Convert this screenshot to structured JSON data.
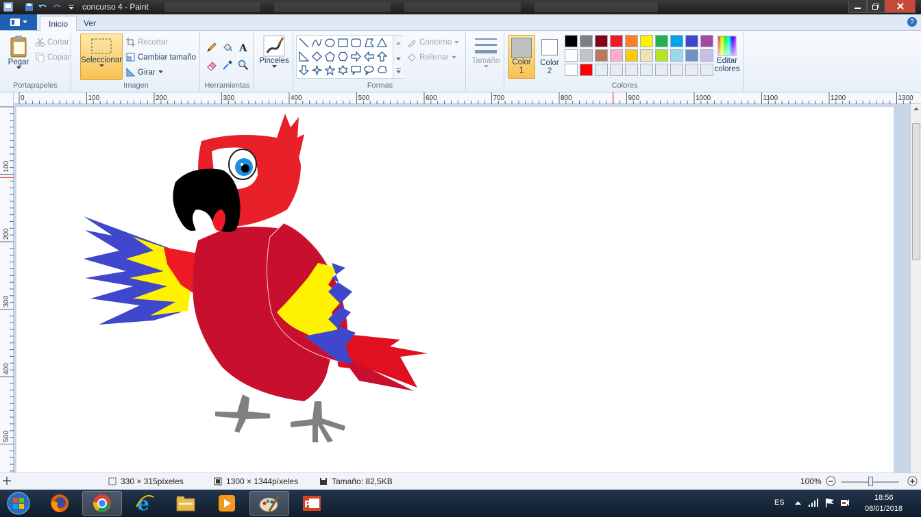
{
  "window": {
    "title": "concurso 4 - Paint"
  },
  "tabs": [
    {
      "label": "Inicio",
      "active": true
    },
    {
      "label": "Ver",
      "active": false
    }
  ],
  "ribbon": {
    "portapapeles": {
      "label": "Portapapeles",
      "paste": "Pegar",
      "cut": "Cortar",
      "copy": "Copiar"
    },
    "imagen": {
      "label": "Imagen",
      "select": "Seleccionar",
      "crop": "Recortar",
      "resize": "Cambiar tamaño",
      "rotate": "Girar"
    },
    "herramientas": {
      "label": "Herramientas"
    },
    "pinceles": {
      "label": "Pinceles"
    },
    "formas": {
      "label": "Formas",
      "outline": "Contorno",
      "fill": "Rellenar"
    },
    "tamano": {
      "label": "Tamaño"
    },
    "colores": {
      "label": "Colores",
      "color1_line1": "Color",
      "color1_line2": "1",
      "color2_line1": "Color",
      "color2_line2": "2",
      "edit_line1": "Editar",
      "edit_line2": "colores",
      "color1_value": "#bfbfbf",
      "color2_value": "#ffffff",
      "palette_row1": [
        "#000000",
        "#7f7f7f",
        "#880015",
        "#ed1c24",
        "#ff7f27",
        "#fff200",
        "#22b14c",
        "#00a2e8",
        "#3f48cc",
        "#a349a4"
      ],
      "palette_row2": [
        "#ffffff",
        "#c3c3c3",
        "#b97a57",
        "#ffaec9",
        "#ffc90e",
        "#efe4b0",
        "#b5e61d",
        "#99d9ea",
        "#7092be",
        "#c8bfe7"
      ],
      "palette_row3": [
        "#ffffff",
        "#ff0000",
        "#e8ecf2",
        "#e8ecf2",
        "#e8ecf2",
        "#e8ecf2",
        "#e8ecf2",
        "#e8ecf2",
        "#e8ecf2",
        "#e8ecf2"
      ]
    }
  },
  "ruler": {
    "h_labels": [
      "0",
      "100",
      "200",
      "300",
      "400",
      "500",
      "600",
      "700",
      "800",
      "900",
      "1000",
      "1100",
      "1200",
      "1300"
    ],
    "v_labels": [
      "100",
      "200",
      "300",
      "400",
      "500"
    ]
  },
  "status": {
    "cursor_pos": "330 × 315píxeles",
    "image_size": "1300 × 1344píxeles",
    "file_size": "Tamaño: 82,5KB",
    "zoom": "100%"
  },
  "taskbar": {
    "apps": [
      "start-button",
      "firefox",
      "chrome",
      "internet-explorer",
      "file-explorer",
      "media-player",
      "paint",
      "powerpoint"
    ],
    "lang": "ES",
    "time": "18:56",
    "date": "08/01/2018"
  }
}
